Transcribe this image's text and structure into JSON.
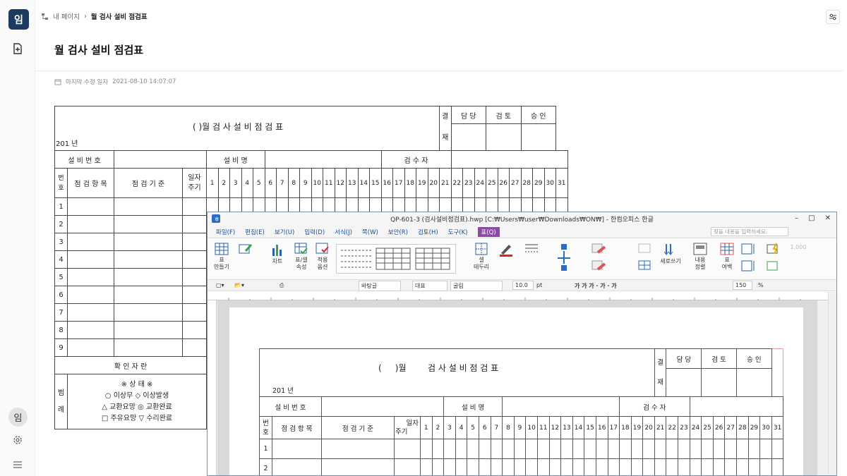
{
  "app": {
    "logo": "임",
    "avatar": "임"
  },
  "breadcrumb": {
    "parent": "내 페이지",
    "sep": "›",
    "current": "월 검사 설비 점검표"
  },
  "page": {
    "title": "월 검사 설비 점검표",
    "meta_label": "마지막 수정 일자",
    "meta_value": "2021-08-10 14:07:07"
  },
  "form": {
    "title": "( )월 검 사 설 비 점 검 표",
    "year": "201 년",
    "approval_label": "결",
    "approval_label2": "재",
    "approvers": [
      "담 당",
      "검 토",
      "승 인"
    ],
    "equip_no": "설 비 번 호",
    "equip_name": "설 비 명",
    "inspector": "검 수 자",
    "col_no": "번",
    "col_no2": "호",
    "col_item": "점 검 항 목",
    "col_std": "점 검 기 준",
    "col_cycle": "일자",
    "col_cycle2": "주기",
    "days": [
      "1",
      "2",
      "3",
      "4",
      "5",
      "6",
      "7",
      "8",
      "9",
      "10",
      "11",
      "12",
      "13",
      "14",
      "15",
      "16",
      "17",
      "18",
      "19",
      "20",
      "21",
      "22",
      "23",
      "24",
      "25",
      "26",
      "27",
      "28",
      "29",
      "30",
      "31"
    ],
    "rows": [
      "1",
      "2",
      "3",
      "4",
      "5",
      "6",
      "7",
      "8",
      "9"
    ],
    "confirm": "확 인 자 란",
    "legend_label": "범",
    "legend_label2": "례",
    "status_title": "※ 상 태 ※",
    "status_1": "○ 이상무 ◇ 이상발생",
    "status_2": "△ 교환요망 ◎ 교환완료",
    "status_3": "□ 주유요망 ▽ 수리완료",
    "cut_1": "일",
    "cut_2": "월"
  },
  "hwp": {
    "window_title": "QP-601-3 (검사설비점검표).hwp [C:₩Users₩user₩Downloads₩ON₩] - 한컴오피스 한글",
    "menus": [
      "파일(F)",
      "편집(E)",
      "보기(U)",
      "입력(D)",
      "서식(J)",
      "쪽(W)",
      "보안(R)",
      "검토(H)",
      "도구(K)",
      "표(Q)"
    ],
    "search_placeholder": "찾을 내용을 입력하세요.",
    "ribbon": {
      "table_make": "표",
      "table_make2": "만들기",
      "chart": "차트",
      "cell_prop": "표/셀",
      "cell_prop2": "속성",
      "apply_opt": "적용",
      "apply_opt2": "옵션",
      "cell_border": "셀",
      "cell_border2": "테두리",
      "vertical": "세로쓰기",
      "content": "내용",
      "content2": "정렬",
      "table_margin": "표",
      "table_margin2": "여백",
      "num": "1,000"
    },
    "toolbar": {
      "style": "바탕글",
      "rep": "대표",
      "font": "굴림",
      "size": "10.0",
      "unit": "pt",
      "zoom": "150",
      "zoom_unit": "%"
    },
    "doc": {
      "title_a": "(",
      "title_b": ")월",
      "title_c": "검 사 설 비 점 검 표",
      "year": "201  년",
      "approval": "결",
      "approval2": "재",
      "approvers": [
        "담 당",
        "검 토",
        "승 인"
      ],
      "equip_no": "설 비 번 호",
      "equip_name": "설 비 명",
      "inspector": "검 수 자",
      "col_no": "번",
      "col_no2": "호",
      "col_item": "점 검 항 목",
      "col_std": "점 검 기 준",
      "col_cycle": "일자",
      "col_cycle2": "주기",
      "rows": [
        "1",
        "2"
      ]
    }
  }
}
